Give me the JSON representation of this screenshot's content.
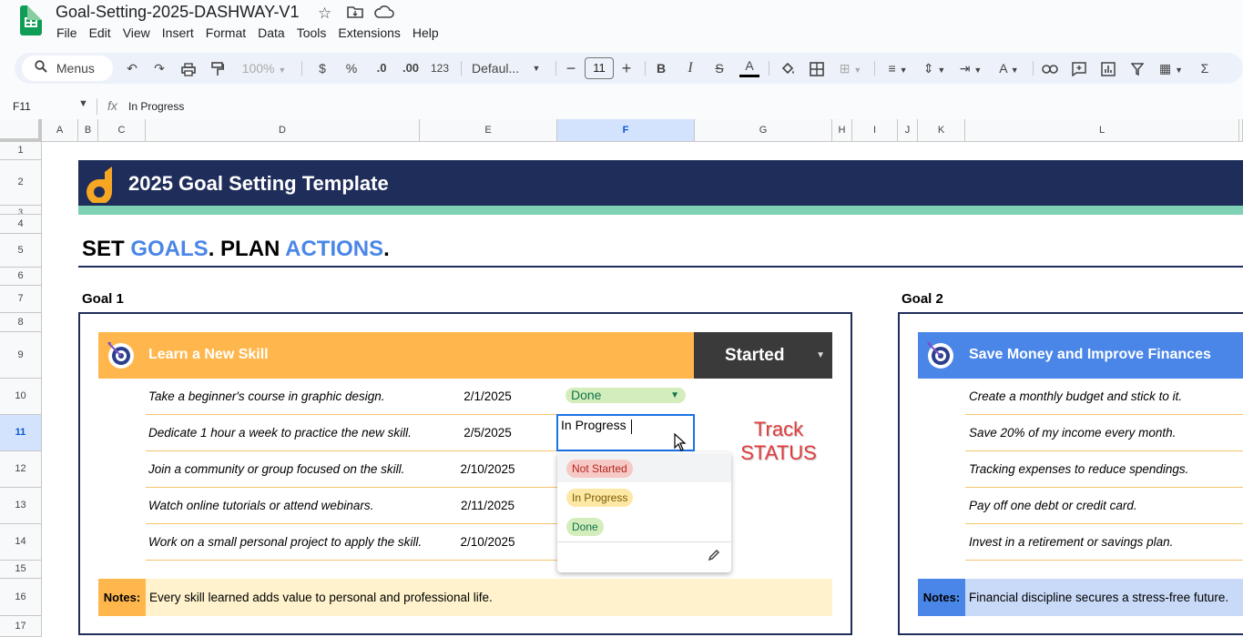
{
  "app": {
    "doc_title": "Goal-Setting-2025-DASHWAY-V1",
    "menus": [
      "File",
      "Edit",
      "View",
      "Insert",
      "Format",
      "Data",
      "Tools",
      "Extensions",
      "Help"
    ]
  },
  "toolbar": {
    "search_label": "Menus",
    "zoom": "100%",
    "currency": "$",
    "percent": "%",
    "dec_less": ".0",
    "dec_more": ".00",
    "number_format": "123",
    "font": "Defaul...",
    "font_size": "11"
  },
  "formula_bar": {
    "cell_ref": "F11",
    "fx": "fx",
    "value": "In Progress"
  },
  "grid": {
    "columns": [
      "A",
      "B",
      "C",
      "D",
      "E",
      "F",
      "G",
      "H",
      "I",
      "J",
      "K",
      "L"
    ],
    "selected_column": "F",
    "rows": [
      "1",
      "2",
      "3",
      "4",
      "5",
      "6",
      "7",
      "8",
      "9",
      "10",
      "11",
      "12",
      "13",
      "14",
      "15",
      "16",
      "17"
    ],
    "selected_row": "11"
  },
  "sheet": {
    "banner_title": "2025 Goal Setting Template",
    "slogan": {
      "w1": "SET ",
      "w2": "GOALS",
      "w3": ". PLAN ",
      "w4": "ACTIONS",
      "w5": "."
    },
    "goal1": {
      "label": "Goal 1",
      "title": "Learn a New Skill",
      "status": "Started",
      "tasks": [
        {
          "text": "Take a beginner's course in graphic design.",
          "date": "2/1/2025"
        },
        {
          "text": "Dedicate 1 hour a week to practice the new skill.",
          "date": "2/5/2025"
        },
        {
          "text": "Join a community or group focused on the skill.",
          "date": "2/10/2025"
        },
        {
          "text": "Watch online tutorials or attend webinars.",
          "date": "2/11/2025"
        },
        {
          "text": "Work on a small personal project to apply the skill.",
          "date": "2/10/2025"
        }
      ],
      "row10_status": "Done",
      "editing_value": "In Progress",
      "notes_label": "Notes:",
      "notes": "Every skill learned adds value to personal and professional life."
    },
    "goal2": {
      "label": "Goal 2",
      "title": "Save Money and Improve Finances",
      "tasks": [
        "Create a monthly budget and stick to it.",
        "Save 20% of my income every month.",
        "Tracking expenses to reduce spendings.",
        "Pay off one debt or credit card.",
        "Invest in a retirement or savings plan."
      ],
      "notes_label": "Notes:",
      "notes": "Financial discipline secures a stress-free future."
    },
    "dropdown_options": [
      {
        "label": "Not Started",
        "bg": "#f6c9c6",
        "fg": "#b3261e"
      },
      {
        "label": "In Progress",
        "bg": "#fde8a6",
        "fg": "#7a5a00"
      },
      {
        "label": "Done",
        "bg": "#d4edbc",
        "fg": "#11734b"
      }
    ],
    "annotation": {
      "line1": "Track",
      "line2": "STATUS"
    }
  },
  "colors": {
    "navy": "#1f2d5a",
    "mint": "#7fd1b4",
    "orange_head": "#ffb74d",
    "blue_head": "#4a86e8",
    "notes_bg_orange": "#fff2cc",
    "notes_bg_blue": "#c9daf8",
    "accent_red": "#e23b3b"
  }
}
